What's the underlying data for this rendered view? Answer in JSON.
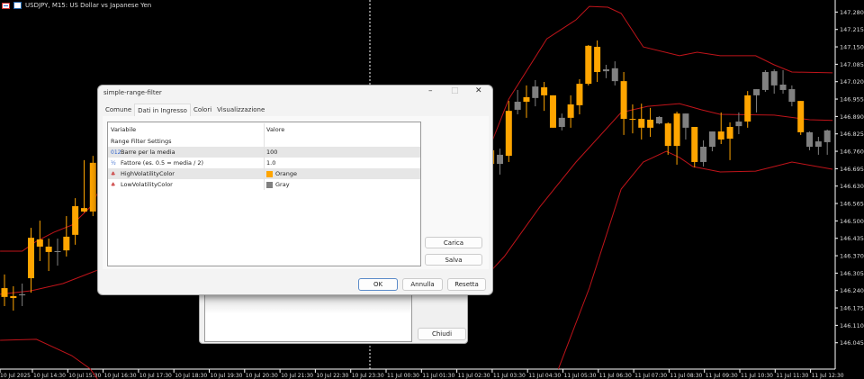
{
  "symbol_title": "USDJPY, M15:  US Dollar vs Japanese Yen",
  "colors": {
    "high": "#ffa500",
    "low": "#808080",
    "band": "#c0141a",
    "axis": "#ffffff"
  },
  "price_axis": [
    "147.280",
    "147.215",
    "147.150",
    "147.085",
    "147.020",
    "146.955",
    "146.890",
    "146.825",
    "146.760",
    "146.695",
    "146.630",
    "146.565",
    "146.500",
    "146.435",
    "146.370",
    "146.305",
    "146.240",
    "146.175",
    "146.110",
    "146.045"
  ],
  "time_axis": [
    "10 Jul 2025",
    "10 Jul 14:30",
    "10 Jul 15:30",
    "10 Jul 16:30",
    "10 Jul 17:30",
    "10 Jul 18:30",
    "10 Jul 19:30",
    "10 Jul 20:30",
    "10 Jul 21:30",
    "10 Jul 22:30",
    "10 Jul 23:30",
    "11 Jul 00:30",
    "11 Jul 01:30",
    "11 Jul 02:30",
    "11 Jul 03:30",
    "11 Jul 04:30",
    "11 Jul 05:30",
    "11 Jul 06:30",
    "11 Jul 07:30",
    "11 Jul 08:30",
    "11 Jul 09:30",
    "11 Jul 10:30",
    "11 Jul 11:30",
    "11 Jul 12:30"
  ],
  "chart_data": {
    "type": "candlestick",
    "candles": [
      [
        0,
        146.3,
        146.249,
        146.216,
        146.182,
        "H"
      ],
      [
        1,
        146.256,
        146.219,
        146.212,
        146.165,
        "H"
      ],
      [
        2,
        146.266,
        146.226,
        146.222,
        146.182,
        "G"
      ],
      [
        3,
        146.474,
        146.437,
        146.286,
        146.232,
        "H"
      ],
      [
        4,
        146.501,
        146.431,
        146.404,
        146.35,
        "H"
      ],
      [
        5,
        146.434,
        146.404,
        146.384,
        146.313,
        "H"
      ],
      [
        6,
        146.434,
        146.387,
        146.384,
        146.333,
        "G"
      ],
      [
        7,
        146.518,
        146.441,
        146.39,
        146.367,
        "H"
      ],
      [
        8,
        146.585,
        146.555,
        146.448,
        146.411,
        "H"
      ],
      [
        9,
        146.727,
        146.548,
        146.535,
        146.532,
        "H"
      ],
      [
        10,
        146.743,
        146.717,
        146.535,
        146.518,
        "H"
      ],
      [
        55,
        146.79,
        146.764,
        146.713,
        146.669,
        "H"
      ],
      [
        56,
        146.77,
        146.747,
        146.713,
        146.673,
        "G"
      ],
      [
        57,
        146.948,
        146.911,
        146.743,
        146.72,
        "H"
      ],
      [
        58,
        146.989,
        146.945,
        146.915,
        146.898,
        "G"
      ],
      [
        59,
        147.006,
        146.962,
        146.945,
        146.885,
        "H"
      ],
      [
        60,
        147.026,
        147.002,
        146.959,
        146.928,
        "G"
      ],
      [
        61,
        147.019,
        146.999,
        146.969,
        146.911,
        "H"
      ],
      [
        62,
        146.969,
        146.969,
        146.848,
        146.848,
        "H"
      ],
      [
        63,
        146.901,
        146.885,
        146.851,
        146.838,
        "G"
      ],
      [
        64,
        146.969,
        146.935,
        146.885,
        146.848,
        "H"
      ],
      [
        65,
        147.029,
        147.012,
        146.932,
        146.898,
        "H"
      ],
      [
        66,
        147.157,
        147.154,
        147.012,
        147.006,
        "H"
      ],
      [
        67,
        147.174,
        147.15,
        147.056,
        147.019,
        "H"
      ],
      [
        68,
        147.083,
        147.066,
        147.059,
        147.033,
        "G"
      ],
      [
        69,
        147.096,
        147.07,
        147.022,
        147.006,
        "G"
      ],
      [
        70,
        147.056,
        147.022,
        146.881,
        146.821,
        "H"
      ],
      [
        71,
        146.935,
        146.881,
        146.878,
        146.827,
        "H"
      ],
      [
        72,
        146.938,
        146.881,
        146.848,
        146.804,
        "H"
      ],
      [
        73,
        146.922,
        146.878,
        146.848,
        146.814,
        "H"
      ],
      [
        74,
        146.891,
        146.888,
        146.864,
        146.861,
        "G"
      ],
      [
        75,
        146.868,
        146.864,
        146.78,
        146.747,
        "H"
      ],
      [
        76,
        146.908,
        146.901,
        146.78,
        146.71,
        "H"
      ],
      [
        77,
        146.901,
        146.901,
        146.848,
        146.804,
        "G"
      ],
      [
        78,
        146.851,
        146.851,
        146.72,
        146.7,
        "H"
      ],
      [
        79,
        146.801,
        146.777,
        146.72,
        146.703,
        "G"
      ],
      [
        80,
        146.834,
        146.834,
        146.777,
        146.76,
        "G"
      ],
      [
        81,
        146.905,
        146.834,
        146.804,
        146.787,
        "H"
      ],
      [
        82,
        146.868,
        146.851,
        146.807,
        146.727,
        "H"
      ],
      [
        83,
        146.905,
        146.871,
        146.854,
        146.824,
        "G"
      ],
      [
        84,
        146.985,
        146.969,
        146.871,
        146.848,
        "H"
      ],
      [
        85,
        146.992,
        146.992,
        146.969,
        146.905,
        "G"
      ],
      [
        86,
        147.063,
        147.056,
        146.989,
        146.982,
        "G"
      ],
      [
        87,
        147.066,
        147.059,
        147.006,
        146.975,
        "G"
      ],
      [
        88,
        147.063,
        147.009,
        146.989,
        146.975,
        "G"
      ],
      [
        89,
        147.006,
        146.992,
        146.945,
        146.928,
        "G"
      ],
      [
        90,
        146.948,
        146.948,
        146.831,
        146.821,
        "H"
      ],
      [
        91,
        146.834,
        146.831,
        146.777,
        146.764,
        "G"
      ],
      [
        92,
        146.814,
        146.797,
        146.777,
        146.747,
        "G"
      ],
      [
        93,
        146.841,
        146.838,
        146.794,
        146.747,
        "G"
      ]
    ],
    "bands": {
      "upper": [
        [
          -0.5,
          146.387
        ],
        [
          2,
          146.387
        ],
        [
          3.6,
          146.424
        ],
        [
          5.6,
          146.458
        ],
        [
          7.6,
          146.484
        ],
        [
          9.7,
          146.552
        ],
        [
          10.5,
          146.602
        ],
        null,
        [
          55,
          146.787
        ],
        [
          57,
          146.955
        ],
        [
          61.3,
          147.18
        ],
        [
          64.6,
          147.251
        ],
        [
          66.1,
          147.301
        ],
        [
          68.2,
          147.298
        ],
        [
          69.7,
          147.275
        ],
        [
          72.2,
          147.15
        ],
        [
          76.3,
          147.117
        ],
        [
          78.3,
          147.13
        ],
        [
          80.9,
          147.117
        ],
        [
          84.9,
          147.117
        ],
        [
          87,
          147.083
        ],
        [
          89,
          147.056
        ],
        [
          93.6,
          147.053
        ]
      ],
      "middle": [
        [
          -0.5,
          146.226
        ],
        [
          3,
          146.239
        ],
        [
          6.6,
          146.266
        ],
        [
          10.5,
          146.316
        ],
        null,
        [
          54.4,
          146.293
        ],
        [
          56.5,
          146.367
        ],
        [
          60.5,
          146.552
        ],
        [
          64.6,
          146.72
        ],
        [
          69.7,
          146.905
        ],
        [
          72.7,
          146.928
        ],
        [
          76.3,
          146.938
        ],
        [
          78.8,
          146.915
        ],
        [
          80.9,
          146.898
        ],
        [
          87,
          146.895
        ],
        [
          91,
          146.878
        ],
        [
          93.6,
          146.875
        ]
      ],
      "lower": [
        [
          -0.5,
          146.054
        ],
        [
          3.6,
          146.058
        ],
        [
          7.6,
          145.997
        ],
        [
          9.7,
          145.947
        ],
        [
          10.5,
          145.91
        ],
        null,
        [
          62.6,
          145.947
        ],
        [
          66.1,
          146.249
        ],
        [
          69.7,
          146.619
        ],
        [
          72.2,
          146.72
        ],
        [
          74.8,
          146.76
        ],
        [
          76.3,
          146.737
        ],
        [
          77.8,
          146.703
        ],
        [
          80.9,
          146.683
        ],
        [
          84.9,
          146.686
        ],
        [
          87,
          146.703
        ],
        [
          89,
          146.72
        ],
        [
          93.6,
          146.693
        ]
      ]
    },
    "ylim": [
      145.9,
      147.325
    ]
  },
  "dialog": {
    "title": "simple-range-filter",
    "tabs": [
      "Comune",
      "Dati in Ingresso",
      "Colori",
      "Visualizzazione"
    ],
    "headers": [
      "Variabile",
      "Valore"
    ],
    "group": "Range Filter Settings",
    "rows": [
      {
        "icon": "012",
        "name": "Barre per la media",
        "value": "100"
      },
      {
        "icon": "½",
        "name": "Fattore (es. 0.5 = media / 2)",
        "value": "1.0"
      },
      {
        "icon": "♣",
        "name": "HighVolatilityColor",
        "value": "Orange",
        "swatch": "#ffa500"
      },
      {
        "icon": "♣",
        "name": "LowVolatilityColor",
        "value": "Gray",
        "swatch": "#808080"
      }
    ],
    "load": "Carica",
    "save": "Salva",
    "ok": "OK",
    "cancel": "Annulla",
    "reset": "Resetta"
  },
  "back_dialog": {
    "close": "Chiudi"
  }
}
